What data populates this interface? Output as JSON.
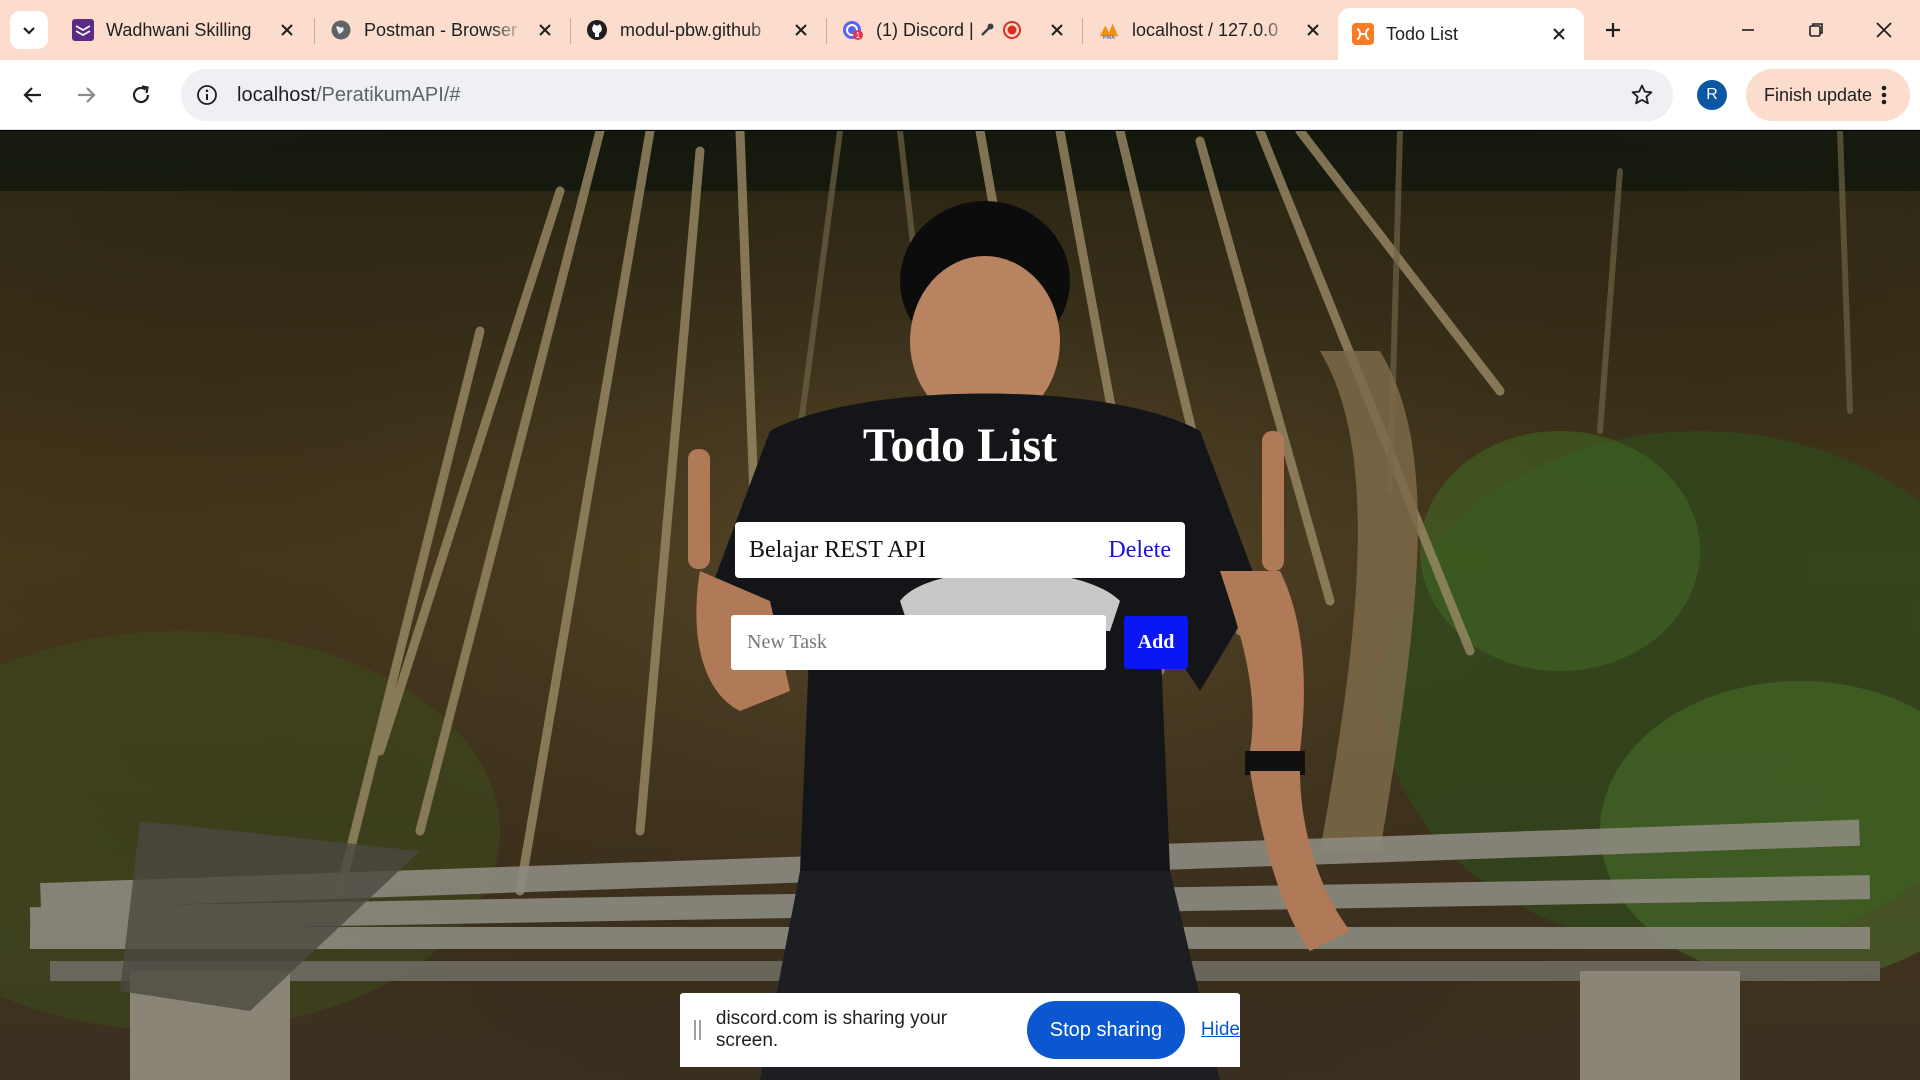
{
  "browser": {
    "tabs": [
      {
        "title": "Wadhwani Skilling",
        "icon": "wadhwani-icon",
        "active": false
      },
      {
        "title": "Postman - Browser",
        "icon": "globe-icon",
        "active": false
      },
      {
        "title": "modul-pbw.github",
        "icon": "github-icon",
        "active": false
      },
      {
        "title": "(1) Discord | ",
        "icon": "discord-icon",
        "active": false
      },
      {
        "title": "localhost / 127.0.0",
        "icon": "phpmyadmin-icon",
        "active": false
      },
      {
        "title": "Todo List",
        "icon": "xampp-icon",
        "active": true
      }
    ],
    "address": {
      "host": "localhost",
      "path": "/PeratikumAPI/#"
    },
    "profile_initial": "R",
    "update_label": "Finish update"
  },
  "page": {
    "title": "Todo List",
    "tasks": [
      {
        "text": "Belajar REST API",
        "action": "Delete"
      }
    ],
    "new_task": {
      "placeholder": "New Task",
      "value": ""
    },
    "add_label": "Add"
  },
  "share_banner": {
    "message": "discord.com is sharing your screen.",
    "stop_label": "Stop sharing",
    "hide_label": "Hide"
  },
  "colors": {
    "tab_strip": "#fbdccd",
    "add_button": "#0a17f2",
    "delete_link": "#1a13d6",
    "stop_sharing": "#0b57d0"
  }
}
